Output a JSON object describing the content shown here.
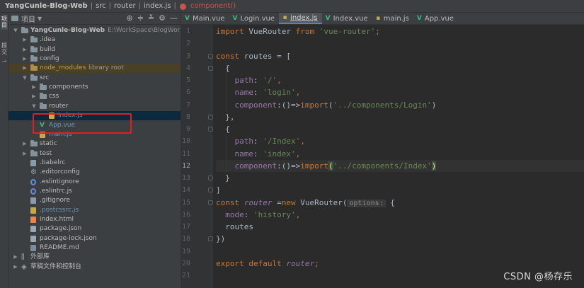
{
  "breadcrumb": {
    "items": [
      "YangCunle-Blog-Web",
      "src",
      "router",
      "index.js"
    ],
    "function": "component()"
  },
  "tool_strip": {
    "tabs": [
      "项目",
      "提交"
    ]
  },
  "project_panel": {
    "header_label": "项目",
    "tools": [
      "⊕",
      "≑",
      "≚",
      "⚙",
      "—"
    ],
    "tree": [
      {
        "label": "YangCunle-Blog-Web",
        "hint": "E:\\WorkSpace\\BlogWorkSpace\\",
        "type": "folder",
        "depth": 0,
        "expanded": true
      },
      {
        "label": ".idea",
        "type": "folder",
        "depth": 1,
        "expanded": false
      },
      {
        "label": "build",
        "type": "folder",
        "depth": 1,
        "expanded": false
      },
      {
        "label": "config",
        "type": "folder",
        "depth": 1,
        "expanded": false
      },
      {
        "label": "node_modules",
        "hint": "library root",
        "type": "lib",
        "depth": 1,
        "expanded": false
      },
      {
        "label": "src",
        "type": "folder",
        "depth": 1,
        "expanded": true
      },
      {
        "label": "components",
        "type": "folder",
        "depth": 2,
        "expanded": false
      },
      {
        "label": "css",
        "type": "folder",
        "depth": 2,
        "expanded": false
      },
      {
        "label": "router",
        "type": "folder",
        "depth": 2,
        "expanded": true
      },
      {
        "label": "index.js",
        "type": "js",
        "depth": 3,
        "selected": true
      },
      {
        "label": "App.vue",
        "type": "vue",
        "depth": 2
      },
      {
        "label": "main.js",
        "type": "js",
        "depth": 2
      },
      {
        "label": "static",
        "type": "folder",
        "depth": 1,
        "expanded": false
      },
      {
        "label": "test",
        "type": "folder",
        "depth": 1,
        "expanded": false
      },
      {
        "label": ".babelrc",
        "type": "file",
        "depth": 1
      },
      {
        "label": ".editorconfig",
        "type": "gear",
        "depth": 1
      },
      {
        "label": ".eslintignore",
        "type": "circle",
        "depth": 1
      },
      {
        "label": ".eslintrc.js",
        "type": "circle",
        "depth": 1
      },
      {
        "label": ".gitignore",
        "type": "file",
        "depth": 1
      },
      {
        "label": ".postcssrc.js",
        "type": "js",
        "depth": 1
      },
      {
        "label": "index.html",
        "type": "html",
        "depth": 1
      },
      {
        "label": "package.json",
        "type": "json",
        "depth": 1
      },
      {
        "label": "package-lock.json",
        "type": "json",
        "depth": 1
      },
      {
        "label": "README.md",
        "type": "md",
        "depth": 1
      },
      {
        "label": "外部库",
        "type": "lib-ext",
        "depth": 0,
        "expanded": false
      },
      {
        "label": "草稿文件和控制台",
        "type": "scratch",
        "depth": 0,
        "expanded": false
      }
    ]
  },
  "tabs": [
    {
      "label": "Main.vue",
      "icon": "V",
      "kind": "vue",
      "active": false
    },
    {
      "label": "Login.vue",
      "icon": "V",
      "kind": "vue",
      "active": false
    },
    {
      "label": "index.js",
      "icon": "js",
      "kind": "js",
      "active": true
    },
    {
      "label": "Index.vue",
      "icon": "V",
      "kind": "vue",
      "active": false
    },
    {
      "label": "main.js",
      "icon": "js",
      "kind": "js",
      "active": false
    },
    {
      "label": "App.vue",
      "icon": "V",
      "kind": "vue",
      "active": false
    }
  ],
  "editor": {
    "current_line": 12,
    "lines": [
      [
        {
          "t": "import ",
          "c": "kw"
        },
        {
          "t": "VueRouter ",
          "c": "cls"
        },
        {
          "t": "from ",
          "c": "kw"
        },
        {
          "t": "'vue-router'",
          "c": "str"
        },
        {
          "t": ";",
          "c": "kw"
        }
      ],
      [],
      [
        {
          "t": "const ",
          "c": "kw"
        },
        {
          "t": "routes",
          "c": "cls"
        },
        {
          "t": " = [",
          "c": "cls"
        }
      ],
      [
        {
          "t": "  {",
          "c": "cls"
        }
      ],
      [
        {
          "t": "    ",
          "c": "cls"
        },
        {
          "t": "path",
          "c": "prop"
        },
        {
          "t": ": ",
          "c": "cls"
        },
        {
          "t": "'/'",
          "c": "str"
        },
        {
          "t": ",",
          "c": "kw"
        }
      ],
      [
        {
          "t": "    ",
          "c": "cls"
        },
        {
          "t": "name",
          "c": "prop"
        },
        {
          "t": ": ",
          "c": "cls"
        },
        {
          "t": "'login'",
          "c": "str"
        },
        {
          "t": ",",
          "c": "kw"
        }
      ],
      [
        {
          "t": "    ",
          "c": "cls"
        },
        {
          "t": "component",
          "c": "prop"
        },
        {
          "t": ":()=>",
          "c": "cls"
        },
        {
          "t": "import",
          "c": "kw"
        },
        {
          "t": "(",
          "c": "cls"
        },
        {
          "t": "'../components/Login'",
          "c": "str"
        },
        {
          "t": ")",
          "c": "cls"
        }
      ],
      [
        {
          "t": "  },",
          "c": "cls"
        }
      ],
      [
        {
          "t": "  {",
          "c": "cls"
        }
      ],
      [
        {
          "t": "    ",
          "c": "cls"
        },
        {
          "t": "path",
          "c": "prop"
        },
        {
          "t": ": ",
          "c": "cls"
        },
        {
          "t": "'/Index'",
          "c": "str"
        },
        {
          "t": ",",
          "c": "kw"
        }
      ],
      [
        {
          "t": "    ",
          "c": "cls"
        },
        {
          "t": "name",
          "c": "prop"
        },
        {
          "t": ": ",
          "c": "cls"
        },
        {
          "t": "'index'",
          "c": "str"
        },
        {
          "t": ",",
          "c": "kw"
        }
      ],
      [
        {
          "t": "    ",
          "c": "cls"
        },
        {
          "t": "component",
          "c": "prop"
        },
        {
          "t": ":()=>",
          "c": "cls"
        },
        {
          "t": "import",
          "c": "kw"
        },
        {
          "t": "(",
          "c": "bracket-match"
        },
        {
          "t": "'../components/Index'",
          "c": "str"
        },
        {
          "t": ")",
          "c": "bracket-match"
        }
      ],
      [
        {
          "t": "  }",
          "c": "cls"
        }
      ],
      [
        {
          "t": "]",
          "c": "cls"
        }
      ],
      [
        {
          "t": "const ",
          "c": "kw"
        },
        {
          "t": "router",
          "c": "var"
        },
        {
          "t": " =",
          "c": "cls"
        },
        {
          "t": "new ",
          "c": "kw"
        },
        {
          "t": "VueRouter(",
          "c": "cls"
        },
        {
          "t": "options:",
          "c": "paramhint"
        },
        {
          "t": " {",
          "c": "cls"
        }
      ],
      [
        {
          "t": "  ",
          "c": "cls"
        },
        {
          "t": "mode",
          "c": "prop"
        },
        {
          "t": ": ",
          "c": "cls"
        },
        {
          "t": "'history'",
          "c": "str"
        },
        {
          "t": ",",
          "c": "kw"
        }
      ],
      [
        {
          "t": "  routes",
          "c": "cls"
        }
      ],
      [
        {
          "t": "})",
          "c": "cls"
        }
      ],
      [],
      [
        {
          "t": "export default ",
          "c": "kw"
        },
        {
          "t": "router",
          "c": "var"
        },
        {
          "t": ";",
          "c": "kw"
        }
      ],
      []
    ]
  },
  "watermark": "CSDN @杨存乐"
}
